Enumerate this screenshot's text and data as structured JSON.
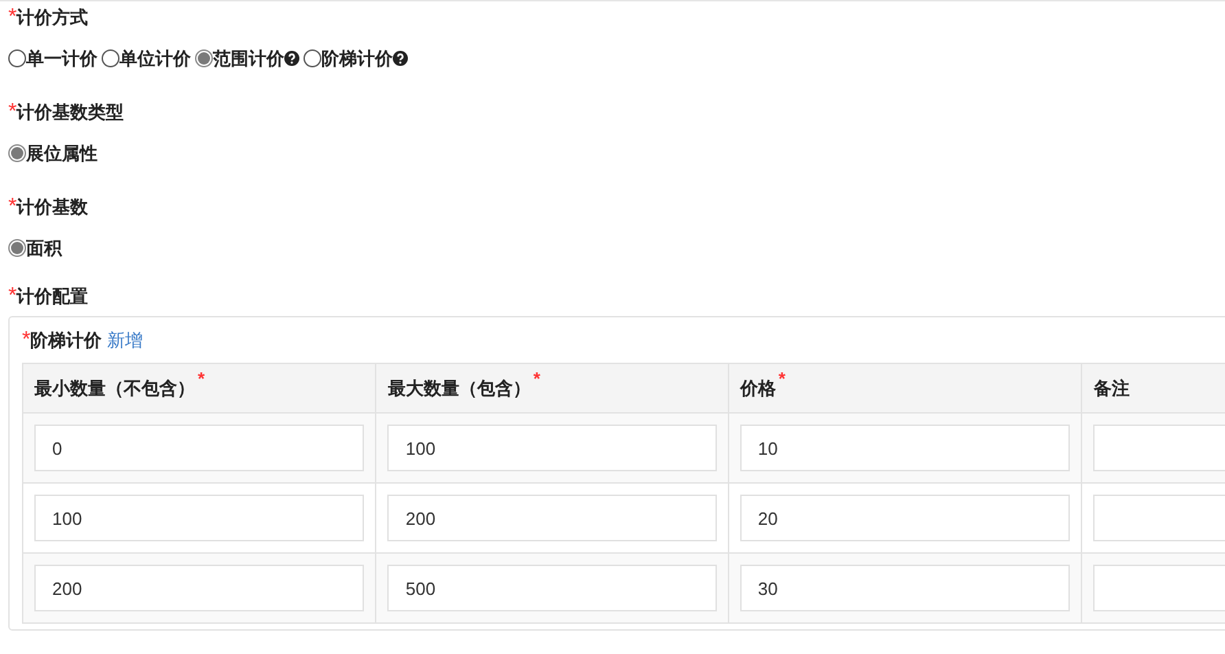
{
  "sections": [
    {
      "asterisk": "*",
      "label": "计价方式",
      "options": [
        {
          "label": "单一计价",
          "selected": false,
          "help": false
        },
        {
          "label": "单位计价",
          "selected": false,
          "help": false
        },
        {
          "label": "范围计价",
          "selected": true,
          "help": true
        },
        {
          "label": "阶梯计价",
          "selected": false,
          "help": true
        }
      ]
    },
    {
      "asterisk": "*",
      "label": "计价基数类型",
      "options": [
        {
          "label": "展位属性",
          "selected": true,
          "help": false
        }
      ]
    },
    {
      "asterisk": "*",
      "label": "计价基数",
      "options": [
        {
          "label": "面积",
          "selected": true,
          "help": false
        }
      ]
    }
  ],
  "config": {
    "asterisk": "*",
    "label": "计价配置",
    "panel": {
      "asterisk": "*",
      "title": "阶梯计价",
      "add_link": "新增",
      "columns": [
        {
          "label": "最小数量（不包含）",
          "asterisk": "*"
        },
        {
          "label": "最大数量（包含）",
          "asterisk": "*"
        },
        {
          "label": "价格",
          "asterisk": "*"
        },
        {
          "label": "备注"
        }
      ],
      "rows": [
        [
          "0",
          "100",
          "10",
          ""
        ],
        [
          "100",
          "200",
          "20",
          ""
        ],
        [
          "200",
          "500",
          "30",
          ""
        ]
      ]
    }
  }
}
